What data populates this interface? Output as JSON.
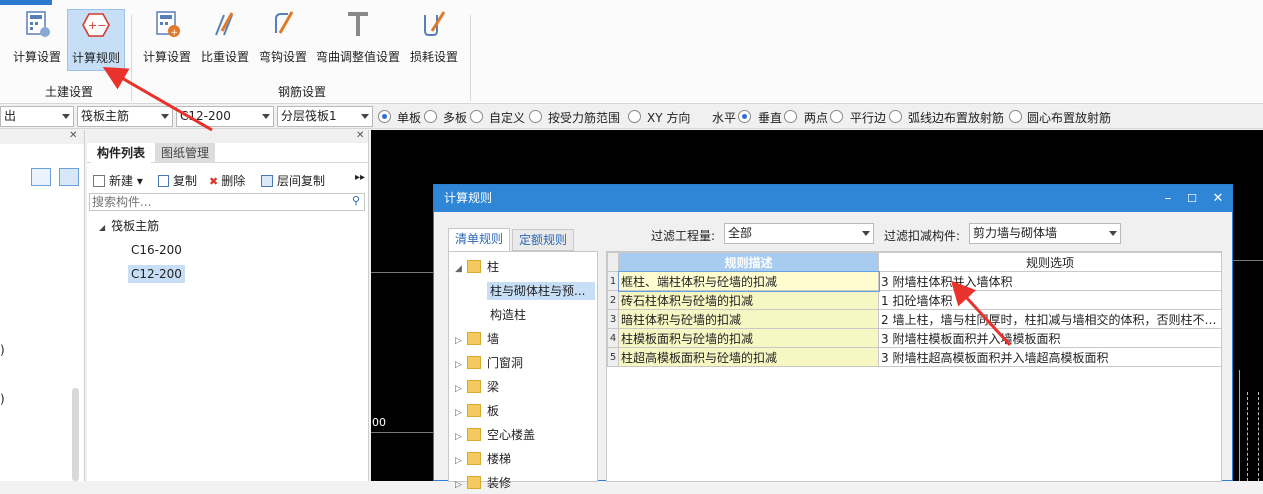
{
  "ribbon": {
    "civil_group": {
      "label": "土建设置",
      "buttons": [
        {
          "label": "计算设置",
          "icon": "calc-settings-icon"
        },
        {
          "label": "计算规则",
          "icon": "calc-rules-icon"
        }
      ]
    },
    "rebar_group": {
      "label": "钢筋设置",
      "buttons": [
        {
          "label": "计算设置",
          "icon": "rebar-calc-settings-icon"
        },
        {
          "label": "比重设置",
          "icon": "density-settings-icon"
        },
        {
          "label": "弯钩设置",
          "icon": "hook-settings-icon"
        },
        {
          "label": "弯曲调整值设置",
          "icon": "bend-adjust-icon"
        },
        {
          "label": "损耗设置",
          "icon": "loss-settings-icon"
        }
      ]
    }
  },
  "toolbar": {
    "combo1": "出",
    "combo2": "筏板主筋",
    "combo3": "C12-200",
    "combo4": "分层筏板1",
    "radios": [
      {
        "label": "单板",
        "checked": true
      },
      {
        "label": "多板",
        "checked": false
      },
      {
        "label": "自定义",
        "checked": false
      },
      {
        "label": "按受力筋范围",
        "checked": false
      },
      {
        "label": "XY 方向",
        "checked": false
      },
      {
        "label": "水平",
        "checked": true
      },
      {
        "label": "垂直",
        "checked": false
      },
      {
        "label": "两点",
        "checked": false
      },
      {
        "label": "平行边",
        "checked": false
      },
      {
        "label": "弧线边布置放射筋",
        "checked": false
      },
      {
        "label": "圆心布置放射筋",
        "checked": false
      }
    ]
  },
  "left_panel": {
    "marks": [
      ")",
      ")"
    ]
  },
  "mid_panel": {
    "tabs": [
      "构件列表",
      "图纸管理"
    ],
    "actions": [
      "新建",
      "复制",
      "删除",
      "层间复制"
    ],
    "search_placeholder": "搜索构件...",
    "tree": {
      "root": "筏板主筋",
      "children": [
        "C16-200",
        "C12-200"
      ]
    }
  },
  "canvas": {
    "text_left": "00"
  },
  "dialog": {
    "title": "计算规则",
    "tabs": [
      "清单规则",
      "定额规则"
    ],
    "filter_qty_label": "过滤工程量:",
    "filter_qty_value": "全部",
    "filter_member_label": "过滤扣减构件:",
    "filter_member_value": "剪力墙与砌体墙",
    "tree": {
      "column": "柱",
      "column_children": [
        "柱与砌体柱与预...",
        "构造柱"
      ],
      "others": [
        "墙",
        "门窗洞",
        "梁",
        "板",
        "空心楼盖",
        "楼梯",
        "装修"
      ]
    },
    "grid": {
      "headers": [
        "规则描述",
        "规则选项"
      ],
      "rows": [
        {
          "n": "1",
          "desc": "框柱、端柱体积与砼墙的扣减",
          "opt": "3 附墙柱体积并入墙体积"
        },
        {
          "n": "2",
          "desc": "砖石柱体积与砼墙的扣减",
          "opt": "1 扣砼墙体积"
        },
        {
          "n": "3",
          "desc": "暗柱体积与砼墙的扣减",
          "opt": "2 墙上柱，墙与柱同厚时，柱扣减与墙相交的体积，否则柱不…"
        },
        {
          "n": "4",
          "desc": "柱模板面积与砼墙的扣减",
          "opt": "3 附墙柱模板面积并入墙模板面积"
        },
        {
          "n": "5",
          "desc": "柱超高模板面积与砼墙的扣减",
          "opt": "3 附墙柱超高模板面积并入墙超高模板面积"
        }
      ]
    }
  },
  "colors": {
    "accent": "#2f85d6",
    "arrow": "#e8322b"
  }
}
